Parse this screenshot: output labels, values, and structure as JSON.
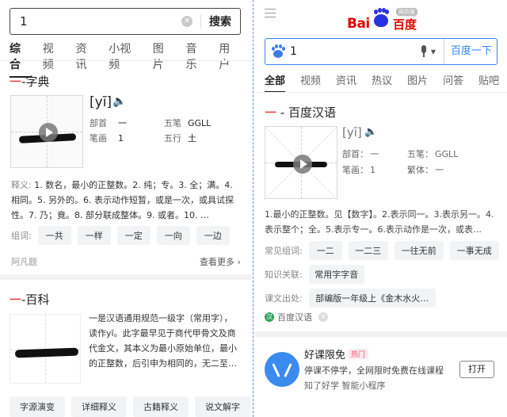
{
  "left": {
    "search": {
      "query": "1",
      "clear_icon": "clear-icon",
      "button": "搜索"
    },
    "tabs": [
      "综合",
      "视频",
      "资讯",
      "小视频",
      "图片",
      "音乐",
      "用户"
    ],
    "dict": {
      "title_dash": "一",
      "title": "-字典",
      "pinyin": "[yī]",
      "radical_label": "部首",
      "radical_value": "一",
      "wubi_label": "五笔",
      "wubi_value": "GGLL",
      "strokes_label": "笔画",
      "strokes_value": "1",
      "wuxing_label": "五行",
      "wuxing_value": "土",
      "meaning_label": "释义:",
      "meaning_text": "1. 数名，最小的正整数。2. 纯；专。3. 全；满。4. 相同。5. 另外的。6. 表示动作短暂，或是一次，或具试探性。7. 乃；竟。8. 部分联成整体。9. 或者。10. …",
      "words_label": "组词:",
      "words": [
        "一共",
        "一样",
        "一定",
        "一向",
        "一边"
      ],
      "source": "阿凡题",
      "see_more": "查看更多 ›"
    },
    "baike": {
      "title_dash": "一",
      "title": "-百科",
      "text": "一是汉语通用规范一级字（常用字），读作yī。此字最早见于商代甲骨文及商代金文，其本义为最小原始单位，最小的正整数，后引申为相同的，无二至…",
      "buttons": [
        "字源演变",
        "详细释义",
        "古籍释义",
        "说文解字"
      ]
    }
  },
  "right": {
    "logo": {
      "text1": "Bai",
      "text2": "百度",
      "badge": "网页版"
    },
    "search": {
      "query": "1",
      "button": "百度一下"
    },
    "tabs": [
      "全部",
      "视频",
      "资讯",
      "热议",
      "图片",
      "问答",
      "贴吧"
    ],
    "hanyu": {
      "title_dash": "一",
      "title": " - 百度汉语",
      "pinyin": "[yī]",
      "radical_label": "部首：",
      "radical_value": "一",
      "wubi_label": "五笔：",
      "wubi_value": "GGLL",
      "strokes_label": "笔画：",
      "strokes_value": "1",
      "trad_label": "繁体：",
      "trad_value": "一",
      "meaning": "1.最小的正整数。见【数字】。2.表示同一。3.表示另一。4.表示整个；全。5.表示专一。6.表示动作是一次，或表…",
      "words_label": "常见组词:",
      "words": [
        "一二",
        "一二三",
        "一往无前",
        "一事无成"
      ],
      "rel_label": "知识关联:",
      "rel_value": "常用字字音",
      "lesson_label": "课文出处:",
      "lesson_value": "部编版一年级上《金木水火…",
      "source": "百度汉语"
    },
    "promo": {
      "title": "好课限免",
      "hot": "热门",
      "desc": "停课不停学，全网限时免费在线课程",
      "sub": "知了好学  智能小程序",
      "open": "打开"
    }
  },
  "colors": {
    "accent_red": "#e02020",
    "baidu_blue": "#3385ff",
    "baidu_red": "#e10601"
  }
}
